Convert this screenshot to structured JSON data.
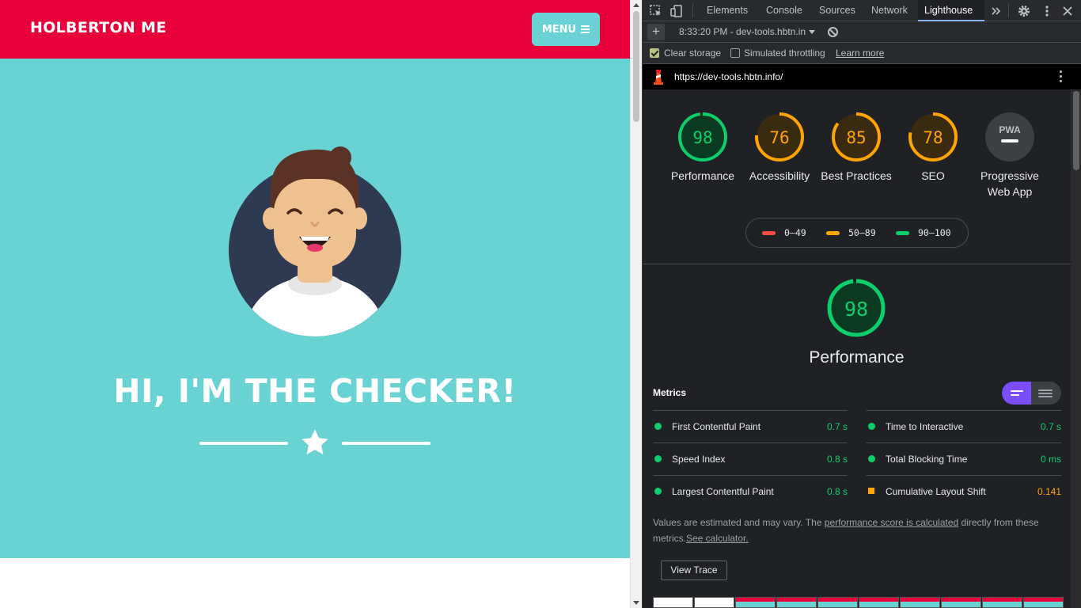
{
  "site": {
    "brand": "HOLBERTON ME",
    "menu_label": "MENU",
    "hero_title": "HI, I'M THE CHECKER!",
    "colors": {
      "nav": "#e8003a",
      "hero": "#69d2d3",
      "menu_button": "#6ad2d4"
    }
  },
  "devtools": {
    "tabs": [
      "Elements",
      "Console",
      "Sources",
      "Network",
      "Lighthouse"
    ],
    "active_tab": "Lighthouse",
    "toolbar": {
      "report_select": "8:33:20 PM - dev-tools.hbtn.in"
    },
    "options": {
      "clear_storage": {
        "label": "Clear storage",
        "checked": true
      },
      "simulated_throttling": {
        "label": "Simulated throttling",
        "checked": false
      },
      "learn_more": "Learn more"
    },
    "url": "https://dev-tools.hbtn.info/",
    "categories": [
      {
        "label": "Performance",
        "score": "98",
        "level": 0.98,
        "color": "#0cce6b"
      },
      {
        "label": "Accessibility",
        "score": "76",
        "level": 0.76,
        "color": "#ffa400"
      },
      {
        "label": "Best Practices",
        "score": "85",
        "level": 0.85,
        "color": "#ffa400"
      },
      {
        "label": "SEO",
        "score": "78",
        "level": 0.78,
        "color": "#ffa400"
      },
      {
        "label": "Progressive Web App",
        "score": "",
        "badge": "PWA"
      }
    ],
    "legend": [
      {
        "range": "0–49",
        "color": "#ff4e42"
      },
      {
        "range": "50–89",
        "color": "#ffa400"
      },
      {
        "range": "90–100",
        "color": "#0cce6b"
      }
    ],
    "performance": {
      "score": "98",
      "level": 0.98,
      "title": "Performance",
      "metrics_heading": "Metrics",
      "metrics": [
        {
          "name": "First Contentful Paint",
          "value": "0.7 s",
          "status": "pass"
        },
        {
          "name": "Time to Interactive",
          "value": "0.7 s",
          "status": "pass"
        },
        {
          "name": "Speed Index",
          "value": "0.8 s",
          "status": "pass"
        },
        {
          "name": "Total Blocking Time",
          "value": "0 ms",
          "status": "pass"
        },
        {
          "name": "Largest Contentful Paint",
          "value": "0.8 s",
          "status": "pass"
        },
        {
          "name": "Cumulative Layout Shift",
          "value": "0.141",
          "status": "average"
        }
      ],
      "note": {
        "prefix": "Values are estimated and may vary. The ",
        "link1": "performance score is calculated",
        "middle": " directly from these metrics.",
        "link2": "See calculator."
      },
      "view_trace": "View Trace"
    }
  }
}
